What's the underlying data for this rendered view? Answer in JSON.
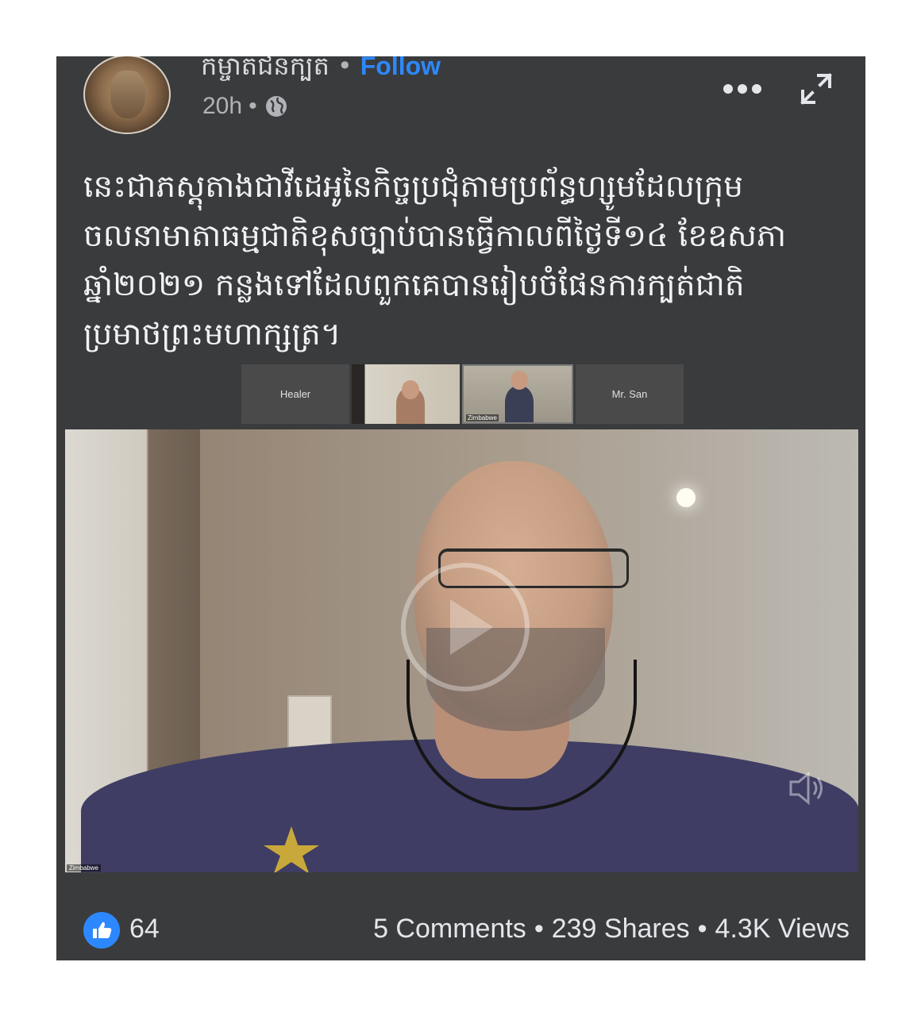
{
  "post": {
    "author": "កម្ចាត់ជនក្បត់",
    "follow_label": "Follow",
    "separator": "•",
    "timestamp": "20h",
    "caption": "នេះជាភស្តុតាងជាវីដេអូនៃកិច្ចប្រជុំតាមប្រព័ន្ធហ្សូមដែលក្រុម\nចលនាមាតាធម្មជាតិខុសច្បាប់បានធ្វើកាលពីថ្ងៃទី១៤ ខែឧសភា\nឆ្នាំ២០២១ កន្លងទៅដែលពួកគេបានរៀបចំផែនការក្បត់ជាតិ\nប្រមាថព្រះមហាក្សត្រ។"
  },
  "video": {
    "participants": [
      {
        "label": "Healer"
      },
      {
        "label": ""
      },
      {
        "label": "Zimbabwe"
      },
      {
        "label": "Mr. San"
      }
    ],
    "main_label": "Zimbabwe"
  },
  "footer": {
    "likes": "64",
    "comments": "5 Comments",
    "shares": "239 Shares",
    "views": "4.3K Views",
    "separator": "•"
  },
  "colors": {
    "background": "#3a3b3c",
    "accent": "#2d88ff",
    "text": "#e4e6eb"
  }
}
